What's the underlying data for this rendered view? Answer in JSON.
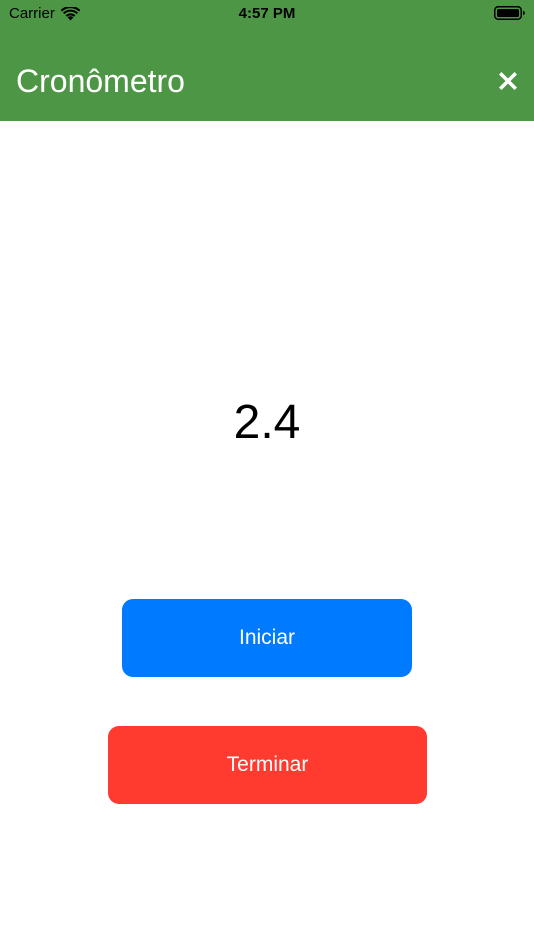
{
  "status_bar": {
    "carrier": "Carrier",
    "time": "4:57 PM",
    "wifi_icon": "wifi-icon",
    "battery_icon": "battery-icon"
  },
  "header": {
    "title": "Cronômetro",
    "close_icon": "close-x-icon",
    "background_color": "#4C9645"
  },
  "timer": {
    "value": "2.4"
  },
  "actions": {
    "start_label": "Iniciar",
    "start_color": "#007AFF",
    "stop_label": "Terminar",
    "stop_color": "#FF3B30"
  }
}
